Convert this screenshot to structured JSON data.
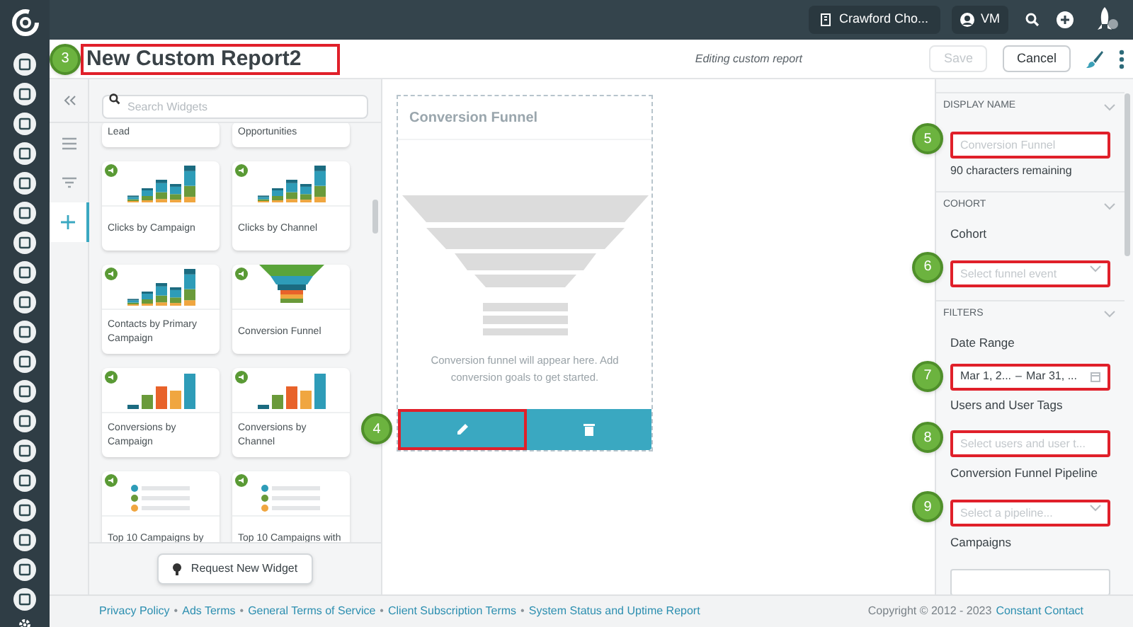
{
  "top_bar": {
    "account": "Crawford Cho...",
    "user": "VM"
  },
  "header": {
    "title": "New Custom Report2",
    "title_callout": "3",
    "status": "Editing custom report",
    "save": {
      "label": "Save",
      "disabled": true
    },
    "cancel": {
      "label": "Cancel",
      "disabled": false
    }
  },
  "panel_tabs": [
    {
      "kind": "list",
      "selected": false
    },
    {
      "kind": "filter",
      "selected": false
    },
    {
      "kind": "plus",
      "selected": true
    }
  ],
  "search": {
    "placeholder": "Search Widgets"
  },
  "widgets": [
    {
      "label": "Lead",
      "kind": "partial"
    },
    {
      "label": "Opportunities",
      "kind": "partial"
    },
    {
      "label": "Clicks by Campaign",
      "kind": "stacked"
    },
    {
      "label": "Clicks by Channel",
      "kind": "stacked"
    },
    {
      "label": "Contacts by Primary Campaign",
      "kind": "stacked"
    },
    {
      "label": "Conversion Funnel",
      "kind": "funnel"
    },
    {
      "label": "Conversions by Campaign",
      "kind": "bars"
    },
    {
      "label": "Conversions by Channel",
      "kind": "bars"
    },
    {
      "label": "Top 10 Campaigns by",
      "kind": "list"
    },
    {
      "label": "Top 10 Campaigns with",
      "kind": "list"
    }
  ],
  "request_button": "Request New Widget",
  "preview": {
    "title": "Conversion Funnel",
    "message": "Conversion funnel will appear here. Add conversion goals to get started.",
    "edit_callout": "4"
  },
  "settings": [
    {
      "heading": "DISPLAY NAME",
      "fields": [
        {
          "kind": "input",
          "placeholder": "Conversion Funnel",
          "callout": "5",
          "helper": "90 characters remaining"
        }
      ]
    },
    {
      "heading": "COHORT",
      "fields": [
        {
          "kind": "select",
          "label": "Cohort",
          "placeholder": "Select funnel event",
          "callout": "6"
        }
      ]
    },
    {
      "heading": "FILTERS",
      "fields": [
        {
          "kind": "date",
          "label": "Date Range",
          "start": "Mar 1, 2...",
          "dash": "–",
          "end": "Mar 31, ...",
          "callout": "7"
        },
        {
          "kind": "input",
          "label": "Users and User Tags",
          "placeholder": "Select users and user t...",
          "callout": "8"
        },
        {
          "kind": "select",
          "label": "Conversion Funnel Pipeline",
          "placeholder": "Select a pipeline...",
          "callout": "9"
        },
        {
          "kind": "input",
          "label": "Campaigns"
        }
      ]
    }
  ],
  "footer": {
    "items": [
      {
        "kind": "link",
        "text": "Privacy Policy"
      },
      {
        "kind": "sep",
        "text": "•"
      },
      {
        "kind": "link",
        "text": "Ads Terms"
      },
      {
        "kind": "sep",
        "text": "•"
      },
      {
        "kind": "link",
        "text": "General Terms of Service"
      },
      {
        "kind": "sep",
        "text": "•"
      },
      {
        "kind": "link",
        "text": "Client Subscription Terms"
      },
      {
        "kind": "sep",
        "text": "•"
      },
      {
        "kind": "link",
        "text": "System Status and Uptime Report"
      }
    ],
    "copyright": "Copyright © 2012 - 2023",
    "brand_link": "Constant Contact"
  }
}
